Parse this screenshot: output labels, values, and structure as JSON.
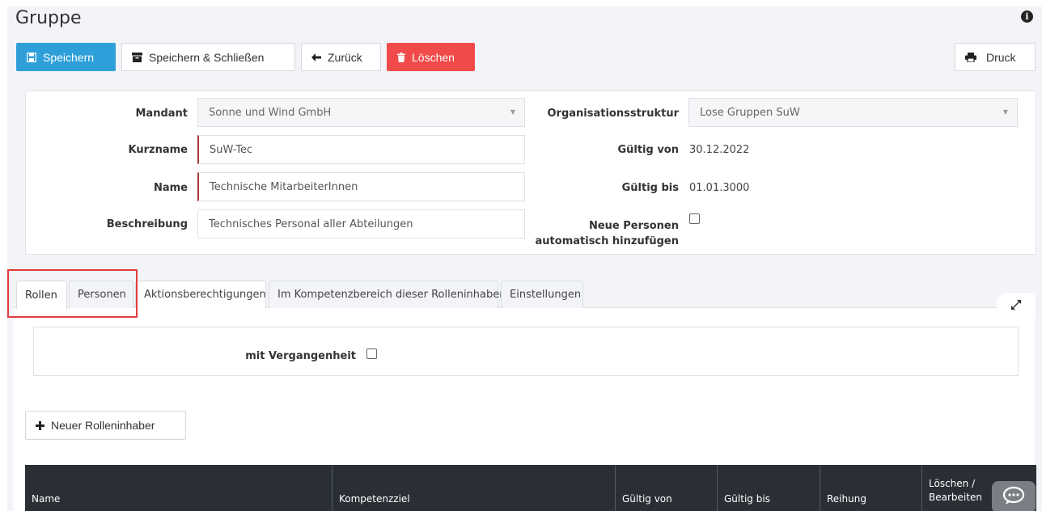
{
  "page": {
    "title": "Gruppe"
  },
  "toolbar": {
    "save": "Speichern",
    "save_close": "Speichern & Schließen",
    "back": "Zurück",
    "delete": "Löschen",
    "print": "Druck"
  },
  "form": {
    "mandant_label": "Mandant",
    "mandant_value": "Sonne und Wind GmbH",
    "kurzname_label": "Kurzname",
    "kurzname_value": "SuW-Tec",
    "name_label": "Name",
    "name_value": "Technische MitarbeiterInnen",
    "beschreibung_label": "Beschreibung",
    "beschreibung_value": "Technisches Personal aller Abteilungen",
    "org_label": "Organisationsstruktur",
    "org_value": "Lose Gruppen SuW",
    "gueltig_von_label": "Gültig von",
    "gueltig_von_value": "30.12.2022",
    "gueltig_bis_label": "Gültig bis",
    "gueltig_bis_value": "01.01.3000",
    "neue_personen_label_1": "Neue Personen",
    "neue_personen_label_2": "automatisch hinzufügen",
    "neue_personen_checked": false
  },
  "tabs": [
    {
      "label": "Rollen",
      "active": true
    },
    {
      "label": "Personen",
      "active": false
    },
    {
      "label": "Aktionsberechtigungen",
      "active": false
    },
    {
      "label": "Im Kompetenzbereich dieser Rolleninhaber",
      "active": false
    },
    {
      "label": "Einstellungen",
      "active": false
    }
  ],
  "filter": {
    "mit_vergangenheit_label": "mit Vergangenheit",
    "checked": false
  },
  "actions": {
    "new_role_holder": "Neuer Rolleninhaber"
  },
  "table": {
    "columns": [
      "Name",
      "Kompetenzziel",
      "Gültig von",
      "Gültig bis",
      "Reihung",
      "Löschen /",
      "Bearbeiten"
    ]
  },
  "colors": {
    "primary": "#2e9fd9",
    "danger": "#f04a4a",
    "table_header": "#2a2f36",
    "highlight": "#e23c3c"
  }
}
